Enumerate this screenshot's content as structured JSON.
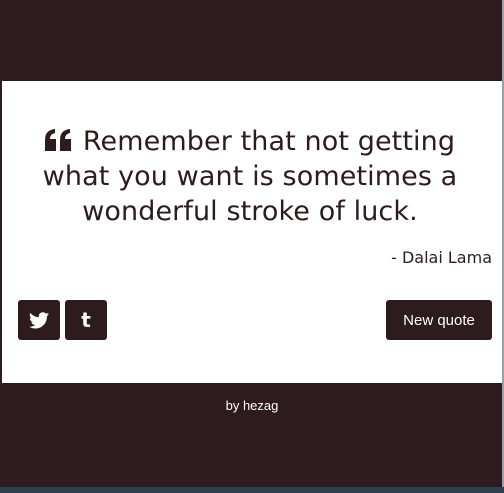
{
  "quote": {
    "text": "Remember that not getting what you want is sometimes a wonderful stroke of luck.",
    "author": "- Dalai Lama",
    "icon": "quote-left-icon"
  },
  "actions": {
    "twitter_icon": "twitter-icon",
    "tumblr_icon": "tumblr-icon",
    "tumblr_glyph": "t",
    "new_quote_label": "New quote"
  },
  "footer": {
    "credit": "by hezag"
  },
  "colors": {
    "background": "#2d1b1d",
    "card": "#ffffff",
    "text": "#2d1b1d",
    "button_text": "#ffffff"
  }
}
